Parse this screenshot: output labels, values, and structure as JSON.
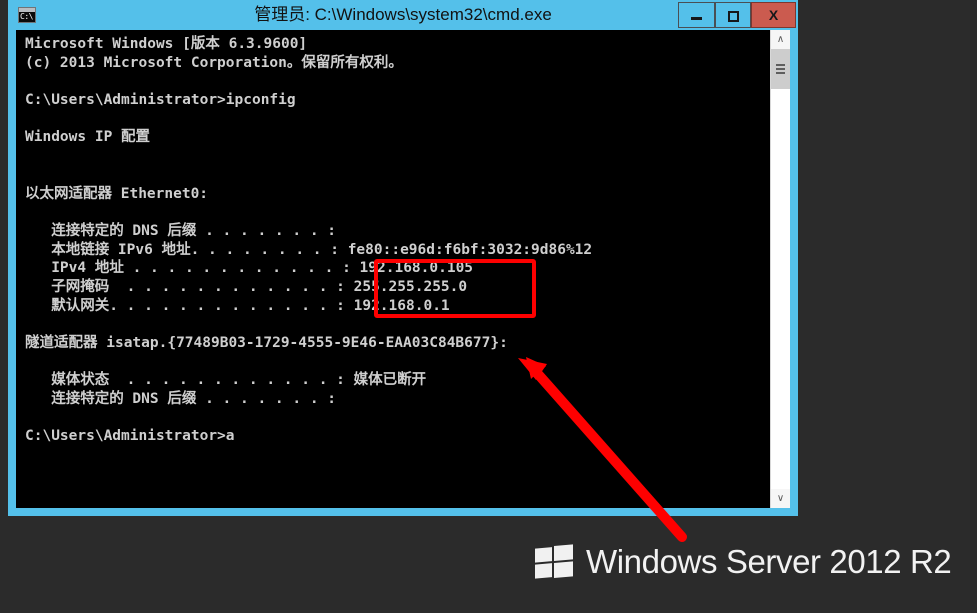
{
  "window": {
    "title": "管理员: C:\\Windows\\system32\\cmd.exe",
    "icon_name": "cmd-icon",
    "icon_prompt": "C:\\",
    "titlebar_color": "#54c0ea",
    "controls": {
      "minimize_label": "",
      "maximize_label": "",
      "close_label": "X",
      "close_color": "#cb5b4f"
    }
  },
  "scrollbar": {
    "up_arrow": "∧",
    "down_arrow": "∨"
  },
  "console": {
    "background": "#000000",
    "foreground": "#cfcfcf",
    "lines": [
      "Microsoft Windows [版本 6.3.9600]",
      "(c) 2013 Microsoft Corporation。保留所有权利。",
      "",
      "C:\\Users\\Administrator>ipconfig",
      "",
      "Windows IP 配置",
      "",
      "",
      "以太网适配器 Ethernet0:",
      "",
      "   连接特定的 DNS 后缀 . . . . . . . :",
      "   本地链接 IPv6 地址. . . . . . . . : fe80::e96d:f6bf:3032:9d86%12",
      "   IPv4 地址 . . . . . . . . . . . . : 192.168.0.105",
      "   子网掩码  . . . . . . . . . . . . : 255.255.255.0",
      "   默认网关. . . . . . . . . . . . . : 192.168.0.1",
      "",
      "隧道适配器 isatap.{77489B03-1729-4555-9E46-EAA03C84B677}:",
      "",
      "   媒体状态  . . . . . . . . . . . . : 媒体已断开",
      "   连接特定的 DNS 后缀 . . . . . . . :",
      "",
      "C:\\Users\\Administrator>a"
    ],
    "values": {
      "os_version": "6.3.9600",
      "copyright_year": "2013",
      "command": "ipconfig",
      "adapter_ethernet": "Ethernet0",
      "ipv6_link_local": "fe80::e96d:f6bf:3032:9d86%12",
      "ipv4_address": "192.168.0.105",
      "subnet_mask": "255.255.255.0",
      "default_gateway": "192.168.0.1",
      "isatap_guid": "{77489B03-1729-4555-9E46-EAA03C84B677}",
      "media_state": "媒体已断开",
      "prompt": "C:\\Users\\Administrator>",
      "typed_input": "a"
    }
  },
  "annotations": {
    "highlight_color": "#fe0000",
    "highlight_target": "ipv4-subnet-gateway",
    "arrow_color": "#fe0000",
    "arrow_from": "680,535",
    "arrow_to": "518,358"
  },
  "branding": {
    "product": "Windows Server 2012 R2",
    "logo_name": "windows-logo",
    "text_color": "#f2f2f2"
  }
}
